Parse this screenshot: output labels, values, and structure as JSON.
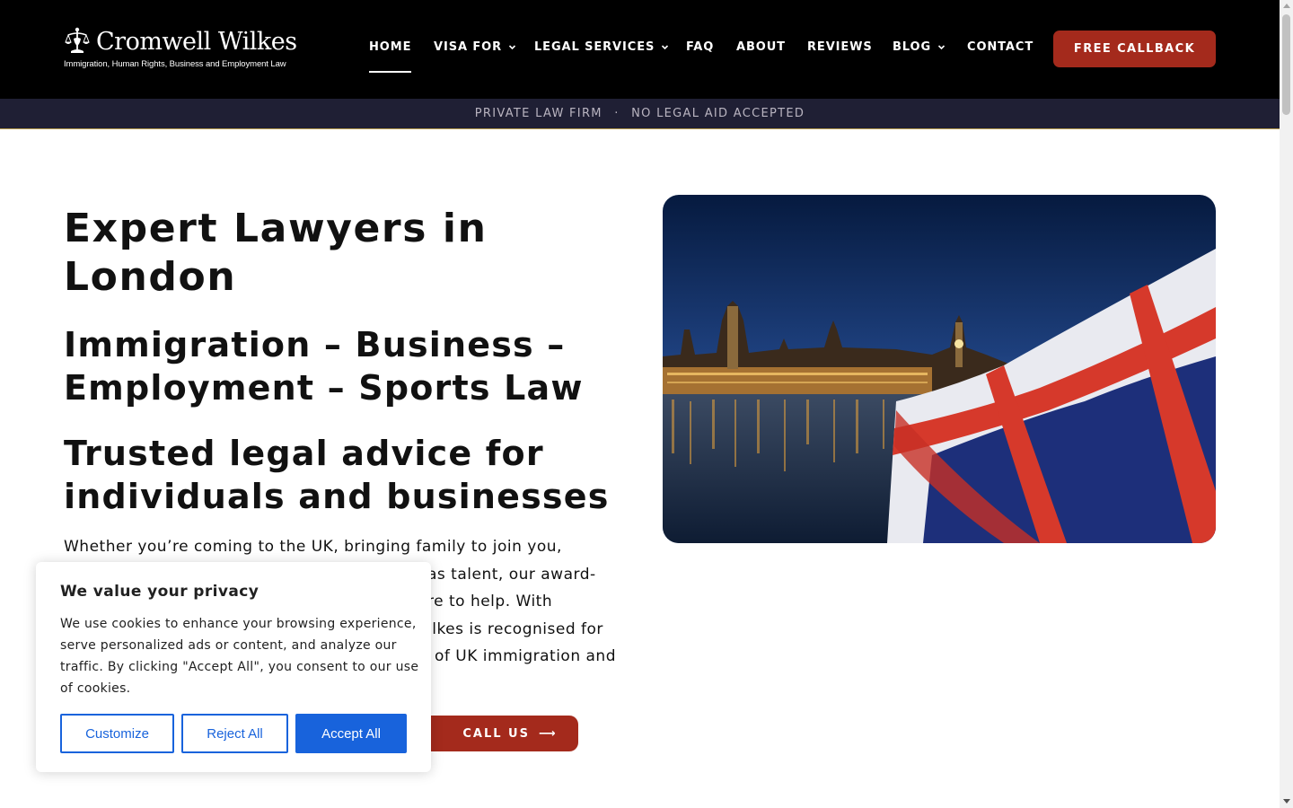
{
  "header": {
    "logo": {
      "name": "Cromwell Wilkes",
      "tagline": "Immigration, Human Rights,  Business and  Employment Law"
    },
    "nav": [
      {
        "label": "HOME",
        "has_dropdown": false,
        "active": true
      },
      {
        "label": "VISA FOR",
        "has_dropdown": true
      },
      {
        "label": "LEGAL SERVICES",
        "has_dropdown": true
      },
      {
        "label": "FAQ",
        "has_dropdown": false
      },
      {
        "label": "ABOUT",
        "has_dropdown": false
      },
      {
        "label": "REVIEWS",
        "has_dropdown": false
      },
      {
        "label": "BLOG",
        "has_dropdown": true
      },
      {
        "label": "CONTACT",
        "has_dropdown": false
      }
    ],
    "callback_label": "FREE CALLBACK"
  },
  "subbar": {
    "left": "PRIVATE LAW FIRM",
    "separator": "·",
    "right": "NO LEGAL AID ACCEPTED"
  },
  "hero": {
    "title": "Expert Lawyers in London",
    "subtitle": "Immigration – Business – Employment – Sports Law",
    "tagline": "Trusted legal advice for individuals and businesses",
    "para_line1": "Whether you’re coming to the UK, bringing family to join you,",
    "para_line2": "as talent, our award-",
    "para_line3": "re to help. With",
    "para_line4": "ilkes is recognised for",
    "para_line5": "of UK immigration and",
    "call_label": "CALL US",
    "call_arrow": "⟶"
  },
  "cookie": {
    "title": "We value your privacy",
    "body": "We use cookies to enhance your browsing experience, serve personalized ads or content, and analyze our traffic. By clicking \"Accept All\", you consent to our use of cookies.",
    "customize": "Customize",
    "reject": "Reject All",
    "accept": "Accept All"
  },
  "colors": {
    "header_bg": "#000000",
    "subbar_bg": "#1f1f34",
    "accent_red": "#a42a1c",
    "cookie_blue": "#1863dc"
  }
}
